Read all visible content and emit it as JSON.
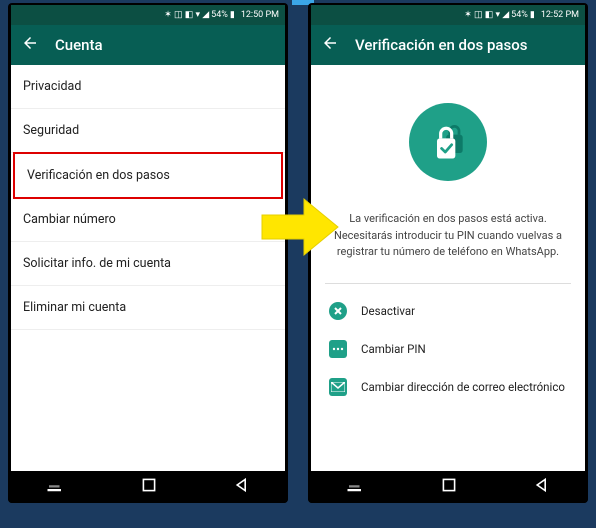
{
  "status": {
    "signal": "54%",
    "time": "12:50 PM",
    "time_right": "12:52 PM",
    "indicators": "📶"
  },
  "left": {
    "title": "Cuenta",
    "items": [
      "Privacidad",
      "Seguridad",
      "Verificación en dos pasos",
      "Cambiar número",
      "Solicitar info. de mi cuenta",
      "Eliminar mi cuenta"
    ]
  },
  "right": {
    "title": "Verificación en dos pasos",
    "description": "La verificación en dos pasos está activa. Necesitarás introducir tu PIN cuando vuelvas a registrar tu número de teléfono en WhatsApp.",
    "actions": {
      "deactivate": "Desactivar",
      "change_pin": "Cambiar PIN",
      "change_email": "Cambiar dirección de correo electrónico"
    }
  }
}
